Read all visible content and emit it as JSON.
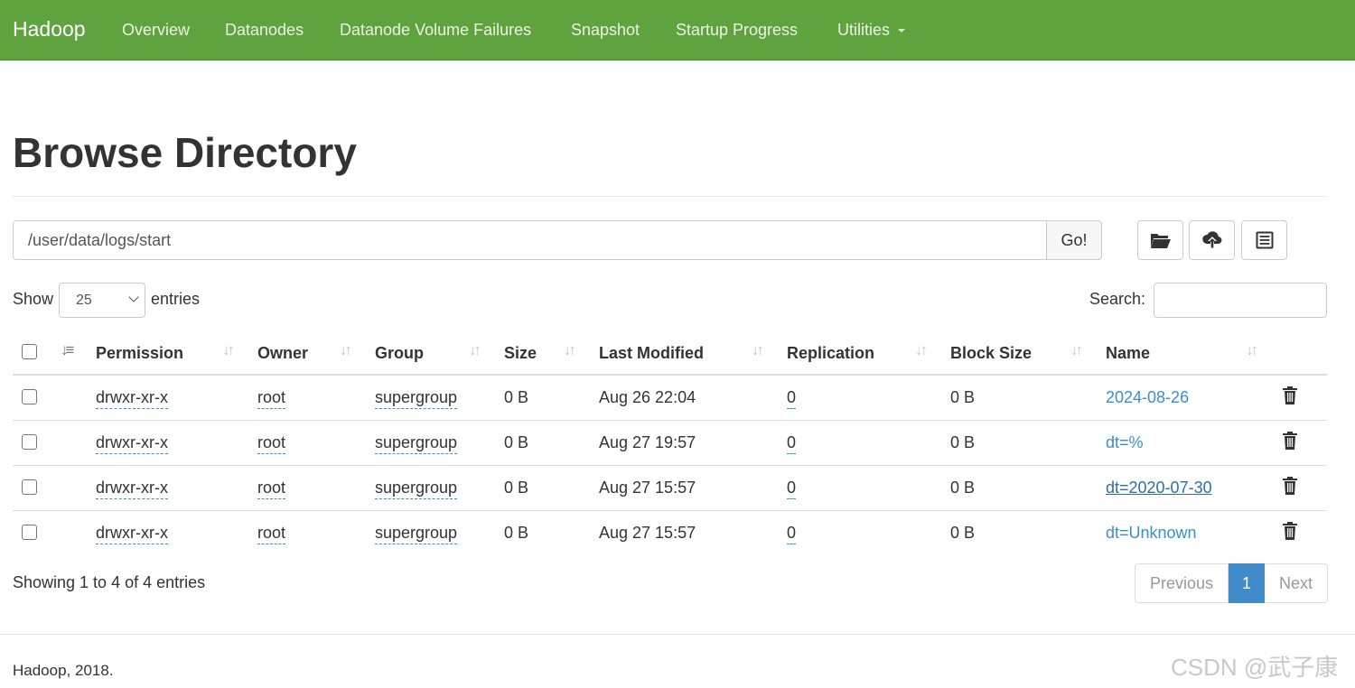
{
  "navbar": {
    "brand": "Hadoop",
    "items": [
      "Overview",
      "Datanodes",
      "Datanode Volume Failures",
      "Snapshot",
      "Startup Progress",
      "Utilities"
    ],
    "bg_color": "#5fa33e"
  },
  "page": {
    "title": "Browse Directory"
  },
  "path_bar": {
    "value": "/user/data/logs/start",
    "go_label": "Go!",
    "tools": [
      "folder-open-icon",
      "cloud-upload-icon",
      "list-alt-icon"
    ]
  },
  "controls": {
    "show_label": "Show",
    "length_value": "25",
    "entries_label": "entries",
    "search_label": "Search:"
  },
  "table": {
    "columns": [
      "Permission",
      "Owner",
      "Group",
      "Size",
      "Last Modified",
      "Replication",
      "Block Size",
      "Name"
    ],
    "rows": [
      {
        "permission": "drwxr-xr-x",
        "owner": "root",
        "group": "supergroup",
        "size": "0 B",
        "modified": "Aug 26 22:04",
        "replication": "0",
        "block_size": "0 B",
        "name": "2024-08-26"
      },
      {
        "permission": "drwxr-xr-x",
        "owner": "root",
        "group": "supergroup",
        "size": "0 B",
        "modified": "Aug 27 19:57",
        "replication": "0",
        "block_size": "0 B",
        "name": "dt=%"
      },
      {
        "permission": "drwxr-xr-x",
        "owner": "root",
        "group": "supergroup",
        "size": "0 B",
        "modified": "Aug 27 15:57",
        "replication": "0",
        "block_size": "0 B",
        "name": "dt=2020-07-30"
      },
      {
        "permission": "drwxr-xr-x",
        "owner": "root",
        "group": "supergroup",
        "size": "0 B",
        "modified": "Aug 27 15:57",
        "replication": "0",
        "block_size": "0 B",
        "name": "dt=Unknown"
      }
    ]
  },
  "pagination": {
    "info": "Showing 1 to 4 of 4 entries",
    "previous": "Previous",
    "current": "1",
    "next": "Next",
    "active_color": "#428bca"
  },
  "footer": {
    "text": "Hadoop, 2018.",
    "watermark": "CSDN @武子康"
  }
}
